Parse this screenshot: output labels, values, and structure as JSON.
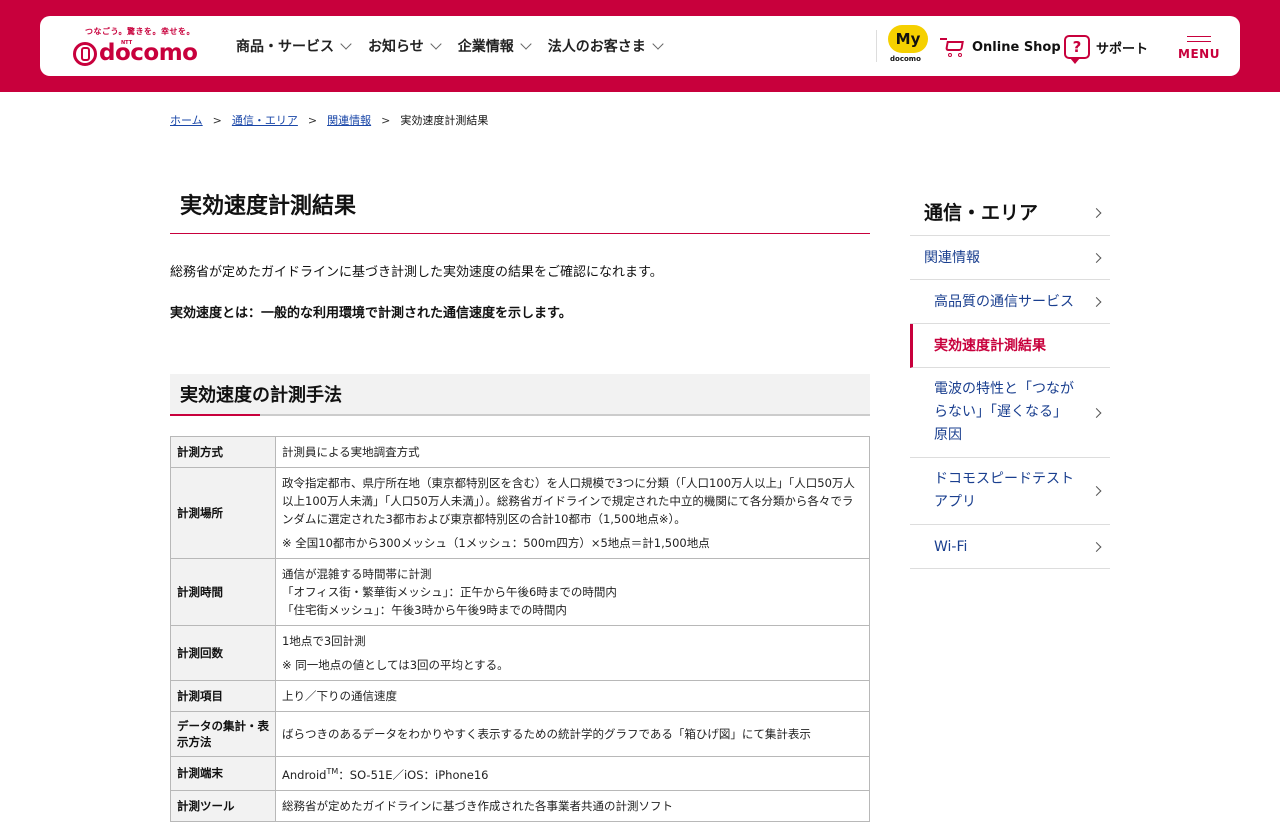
{
  "header": {
    "logo": {
      "tagline": "つなごう。驚きを。幸せを。",
      "ntt": "NTT",
      "wordmark": "docomo"
    },
    "nav": [
      {
        "label": "商品・サービス"
      },
      {
        "label": "お知らせ"
      },
      {
        "label": "企業情報"
      },
      {
        "label": "法人のお客さま"
      }
    ],
    "my_docomo": {
      "badge": "My",
      "sub": "docomo"
    },
    "online_shop": "Online Shop",
    "support": "サポート",
    "menu": "MENU"
  },
  "breadcrumb": [
    {
      "label": "ホーム",
      "link": true
    },
    {
      "label": "通信・エリア",
      "link": true
    },
    {
      "label": "関連情報",
      "link": true
    },
    {
      "label": "実効速度計測結果",
      "link": false
    }
  ],
  "main": {
    "title": "実効速度計測結果",
    "lead": "総務省が定めたガイドラインに基づき計測した実効速度の結果をご確認になれます。",
    "definition": "実効速度とは：一般的な利用環境で計測された通信速度を示します。",
    "section_title": "実効速度の計測手法",
    "table": [
      {
        "head": "計測方式",
        "lines": [
          "計測員による実地調査方式"
        ]
      },
      {
        "head": "計測場所",
        "lines": [
          "政令指定都市、県庁所在地（東京都特別区を含む）を人口規模で3つに分類（「人口100万人以上」「人口50万人以上100万人未満」「人口50万人未満」）。総務省ガイドラインで規定された中立的機関にて各分類から各々でランダムに選定された3都市および東京都特別区の合計10都市（1,500地点※）。"
        ],
        "note": "※ 全国10都市から300メッシュ（1メッシュ：500m四方）×5地点＝計1,500地点"
      },
      {
        "head": "計測時間",
        "lines": [
          "通信が混雑する時間帯に計測",
          "「オフィス街・繁華街メッシュ」：正午から午後6時までの時間内",
          "「住宅街メッシュ」：午後3時から午後9時までの時間内"
        ]
      },
      {
        "head": "計測回数",
        "lines": [
          "1地点で3回計測"
        ],
        "note": "※ 同一地点の値としては3回の平均とする。"
      },
      {
        "head": "計測項目",
        "lines": [
          "上り／下りの通信速度"
        ]
      },
      {
        "head": "データの集計・表示方法",
        "lines": [
          "ばらつきのあるデータをわかりやすく表示するための統計学的グラフである「箱ひげ図」にて集計表示"
        ]
      },
      {
        "head": "計測端末",
        "lines_pre": "Android",
        "sup": "TM",
        "lines_post": "：SO-51E／iOS：iPhone16"
      },
      {
        "head": "計測ツール",
        "lines": [
          "総務省が定めたガイドラインに基づき作成された各事業者共通の計測ソフト"
        ]
      }
    ]
  },
  "sidebar": {
    "heading": "通信・エリア",
    "level2": "関連情報",
    "items": [
      {
        "label": "高品質の通信サービス",
        "active": false
      },
      {
        "label": "実効速度計測結果",
        "active": true
      },
      {
        "label": "電波の特性と「つながらない」「遅くなる」原因",
        "active": false
      },
      {
        "label": "ドコモスピードテストアプリ",
        "active": false
      },
      {
        "label": "Wi-Fi",
        "active": false
      }
    ]
  },
  "colors": {
    "brand": "#c8003c",
    "link": "#1a47a8",
    "accent_yellow": "#f5d000"
  }
}
